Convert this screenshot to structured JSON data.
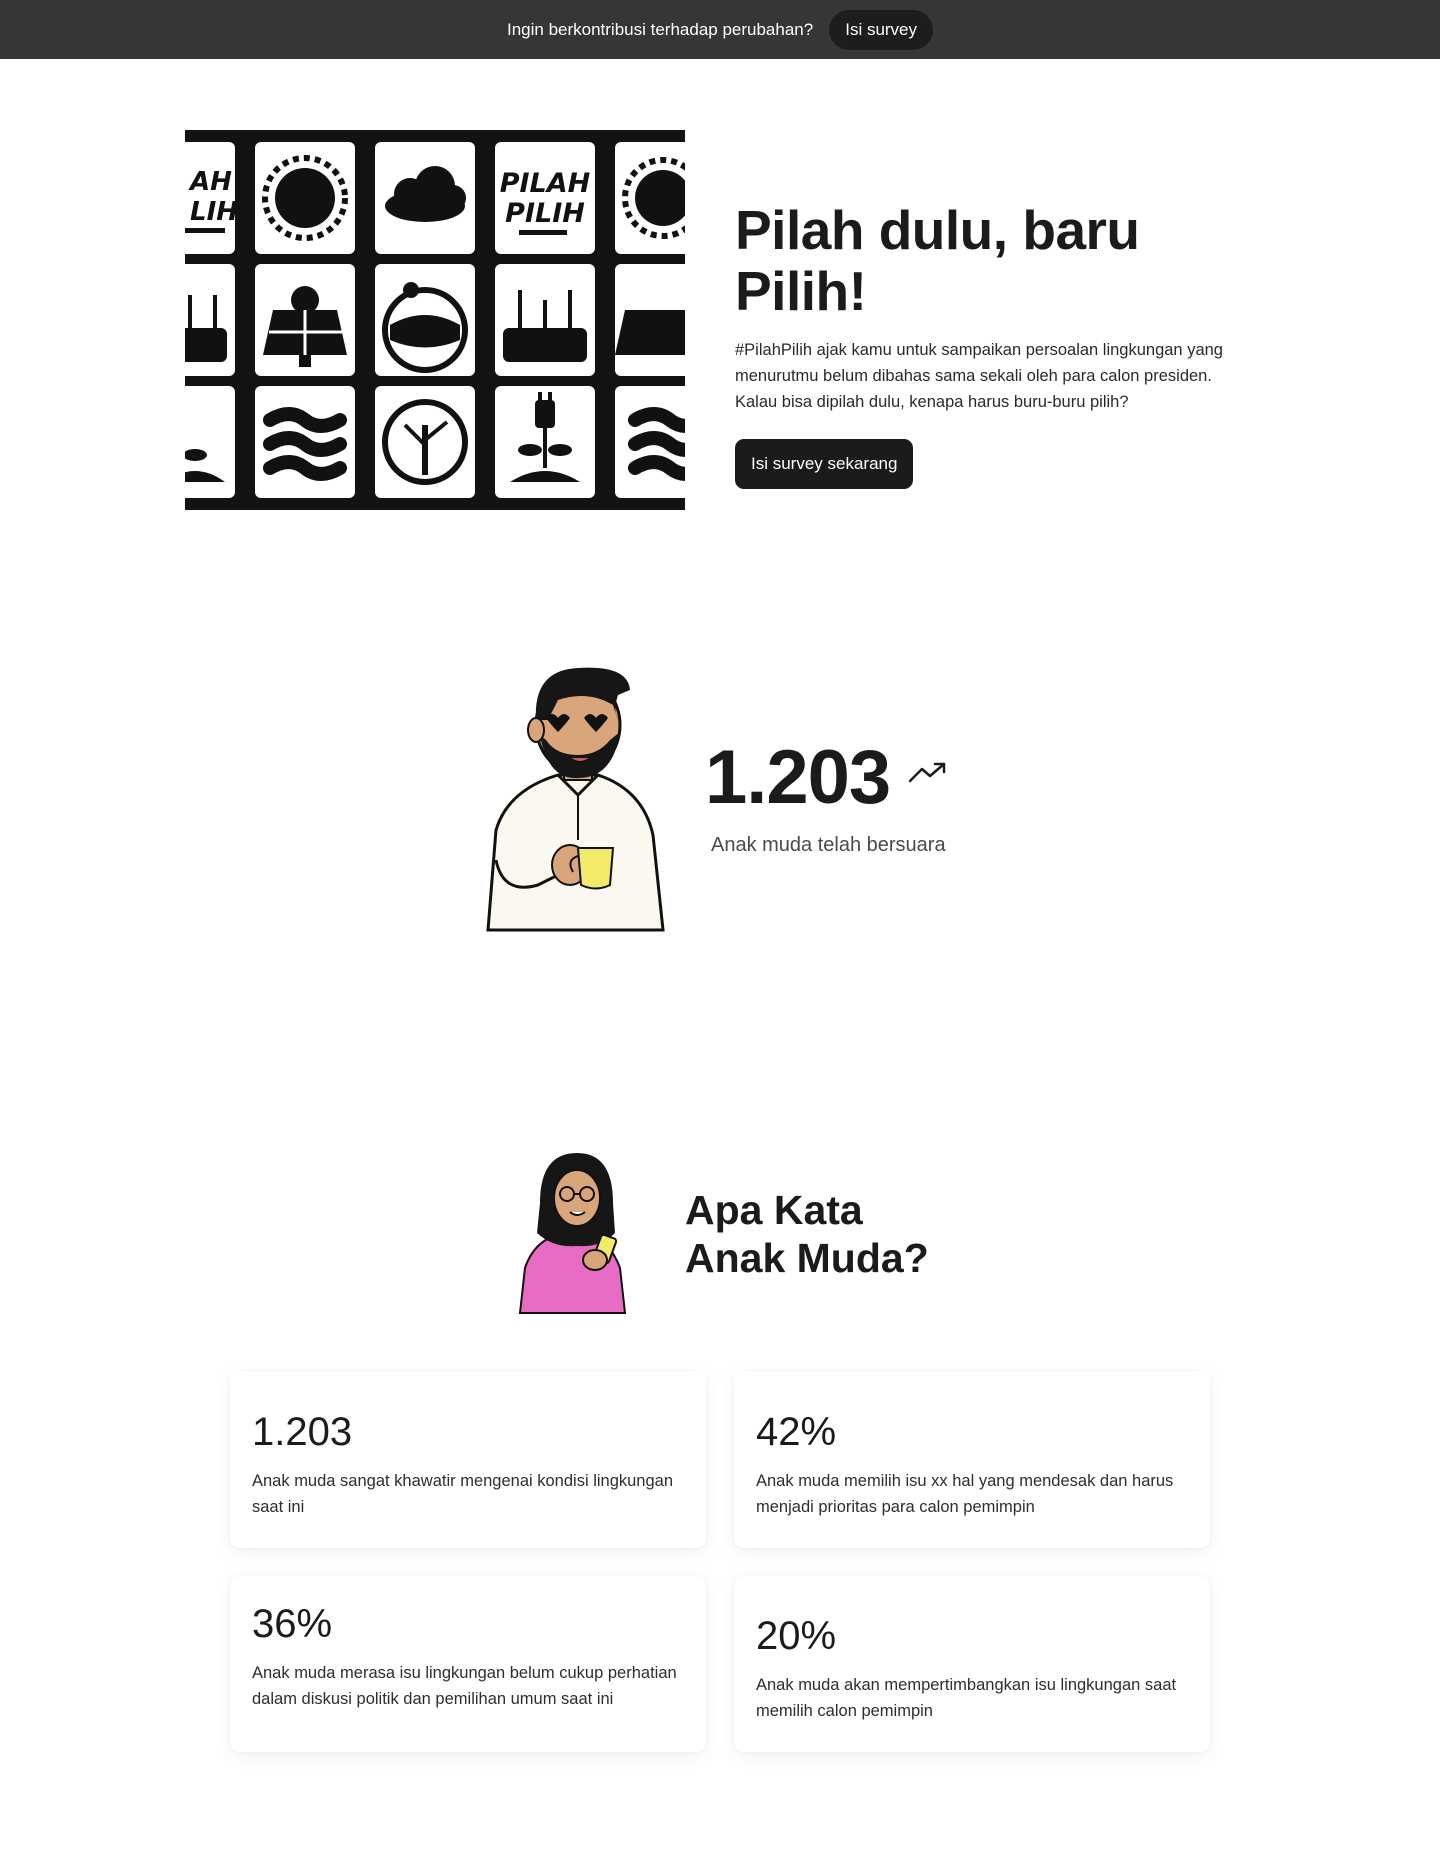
{
  "banner": {
    "text": "Ingin berkontribusi terhadap perubahan?",
    "button_label": "Isi survey"
  },
  "hero": {
    "art_labels": [
      "PILAH",
      "PILIH",
      "AH",
      "LIH"
    ],
    "title": "Pilah dulu, baru Pilih!",
    "description": "#PilahPilih ajak kamu untuk sampaikan persoalan lingkungan yang menurutmu belum dibahas sama sekali oleh para calon presiden. Kalau bisa dipilah dulu, kenapa harus buru-buru pilih?",
    "button_label": "Isi survey sekarang"
  },
  "counter": {
    "value": "1.203",
    "label": "Anak muda telah bersuara",
    "icon": "trending-up-icon"
  },
  "opinions": {
    "title_line1": "Apa Kata",
    "title_line2": "Anak Muda?",
    "cards": [
      {
        "value": "1.203",
        "text": "Anak muda sangat khawatir mengenai kondisi lingkungan saat ini"
      },
      {
        "value": "42%",
        "text": "Anak muda memilih isu xx hal yang mendesak dan harus menjadi prioritas para calon pemimpin"
      },
      {
        "value": "36%",
        "text": "Anak muda merasa isu lingkungan belum cukup perhatian dalam diskusi politik dan pemilihan umum saat ini"
      },
      {
        "value": "20%",
        "text": "Anak muda akan mempertimbangkan isu lingkungan saat memilih calon pemimpin"
      }
    ]
  },
  "colors": {
    "banner_bg": "#363636",
    "button_dark": "#1b1b1b",
    "mug_yellow": "#f4ea6a",
    "shirt_pink": "#e86cc4",
    "skin": "#d9a57a"
  }
}
